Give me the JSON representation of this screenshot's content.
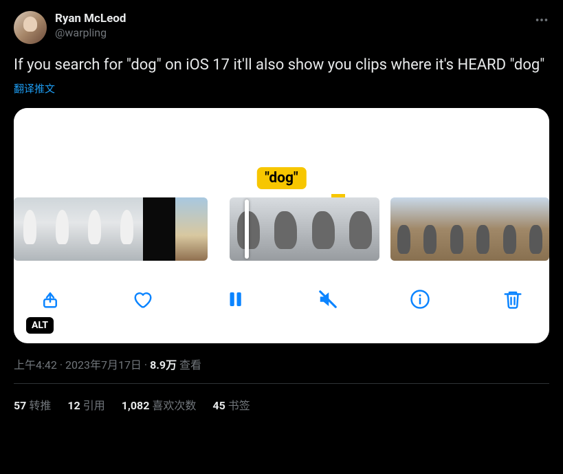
{
  "user": {
    "display_name": "Ryan McLeod",
    "handle": "@warpling"
  },
  "tweet_text": "If you search for \"dog\" on iOS 17 it'll also show you clips where it's HEARD \"dog\"",
  "translate_label": "翻译推文",
  "media": {
    "search_term_label": "\"dog\"",
    "alt_badge": "ALT"
  },
  "meta": {
    "time": "上午4:42",
    "date": "2023年7月17日",
    "views_count": "8.9万",
    "views_label": "查看",
    "separator": " · "
  },
  "stats": {
    "retweets_count": "57",
    "retweets_label": "转推",
    "quotes_count": "12",
    "quotes_label": "引用",
    "likes_count": "1,082",
    "likes_label": "喜欢次数",
    "bookmarks_count": "45",
    "bookmarks_label": "书签"
  }
}
